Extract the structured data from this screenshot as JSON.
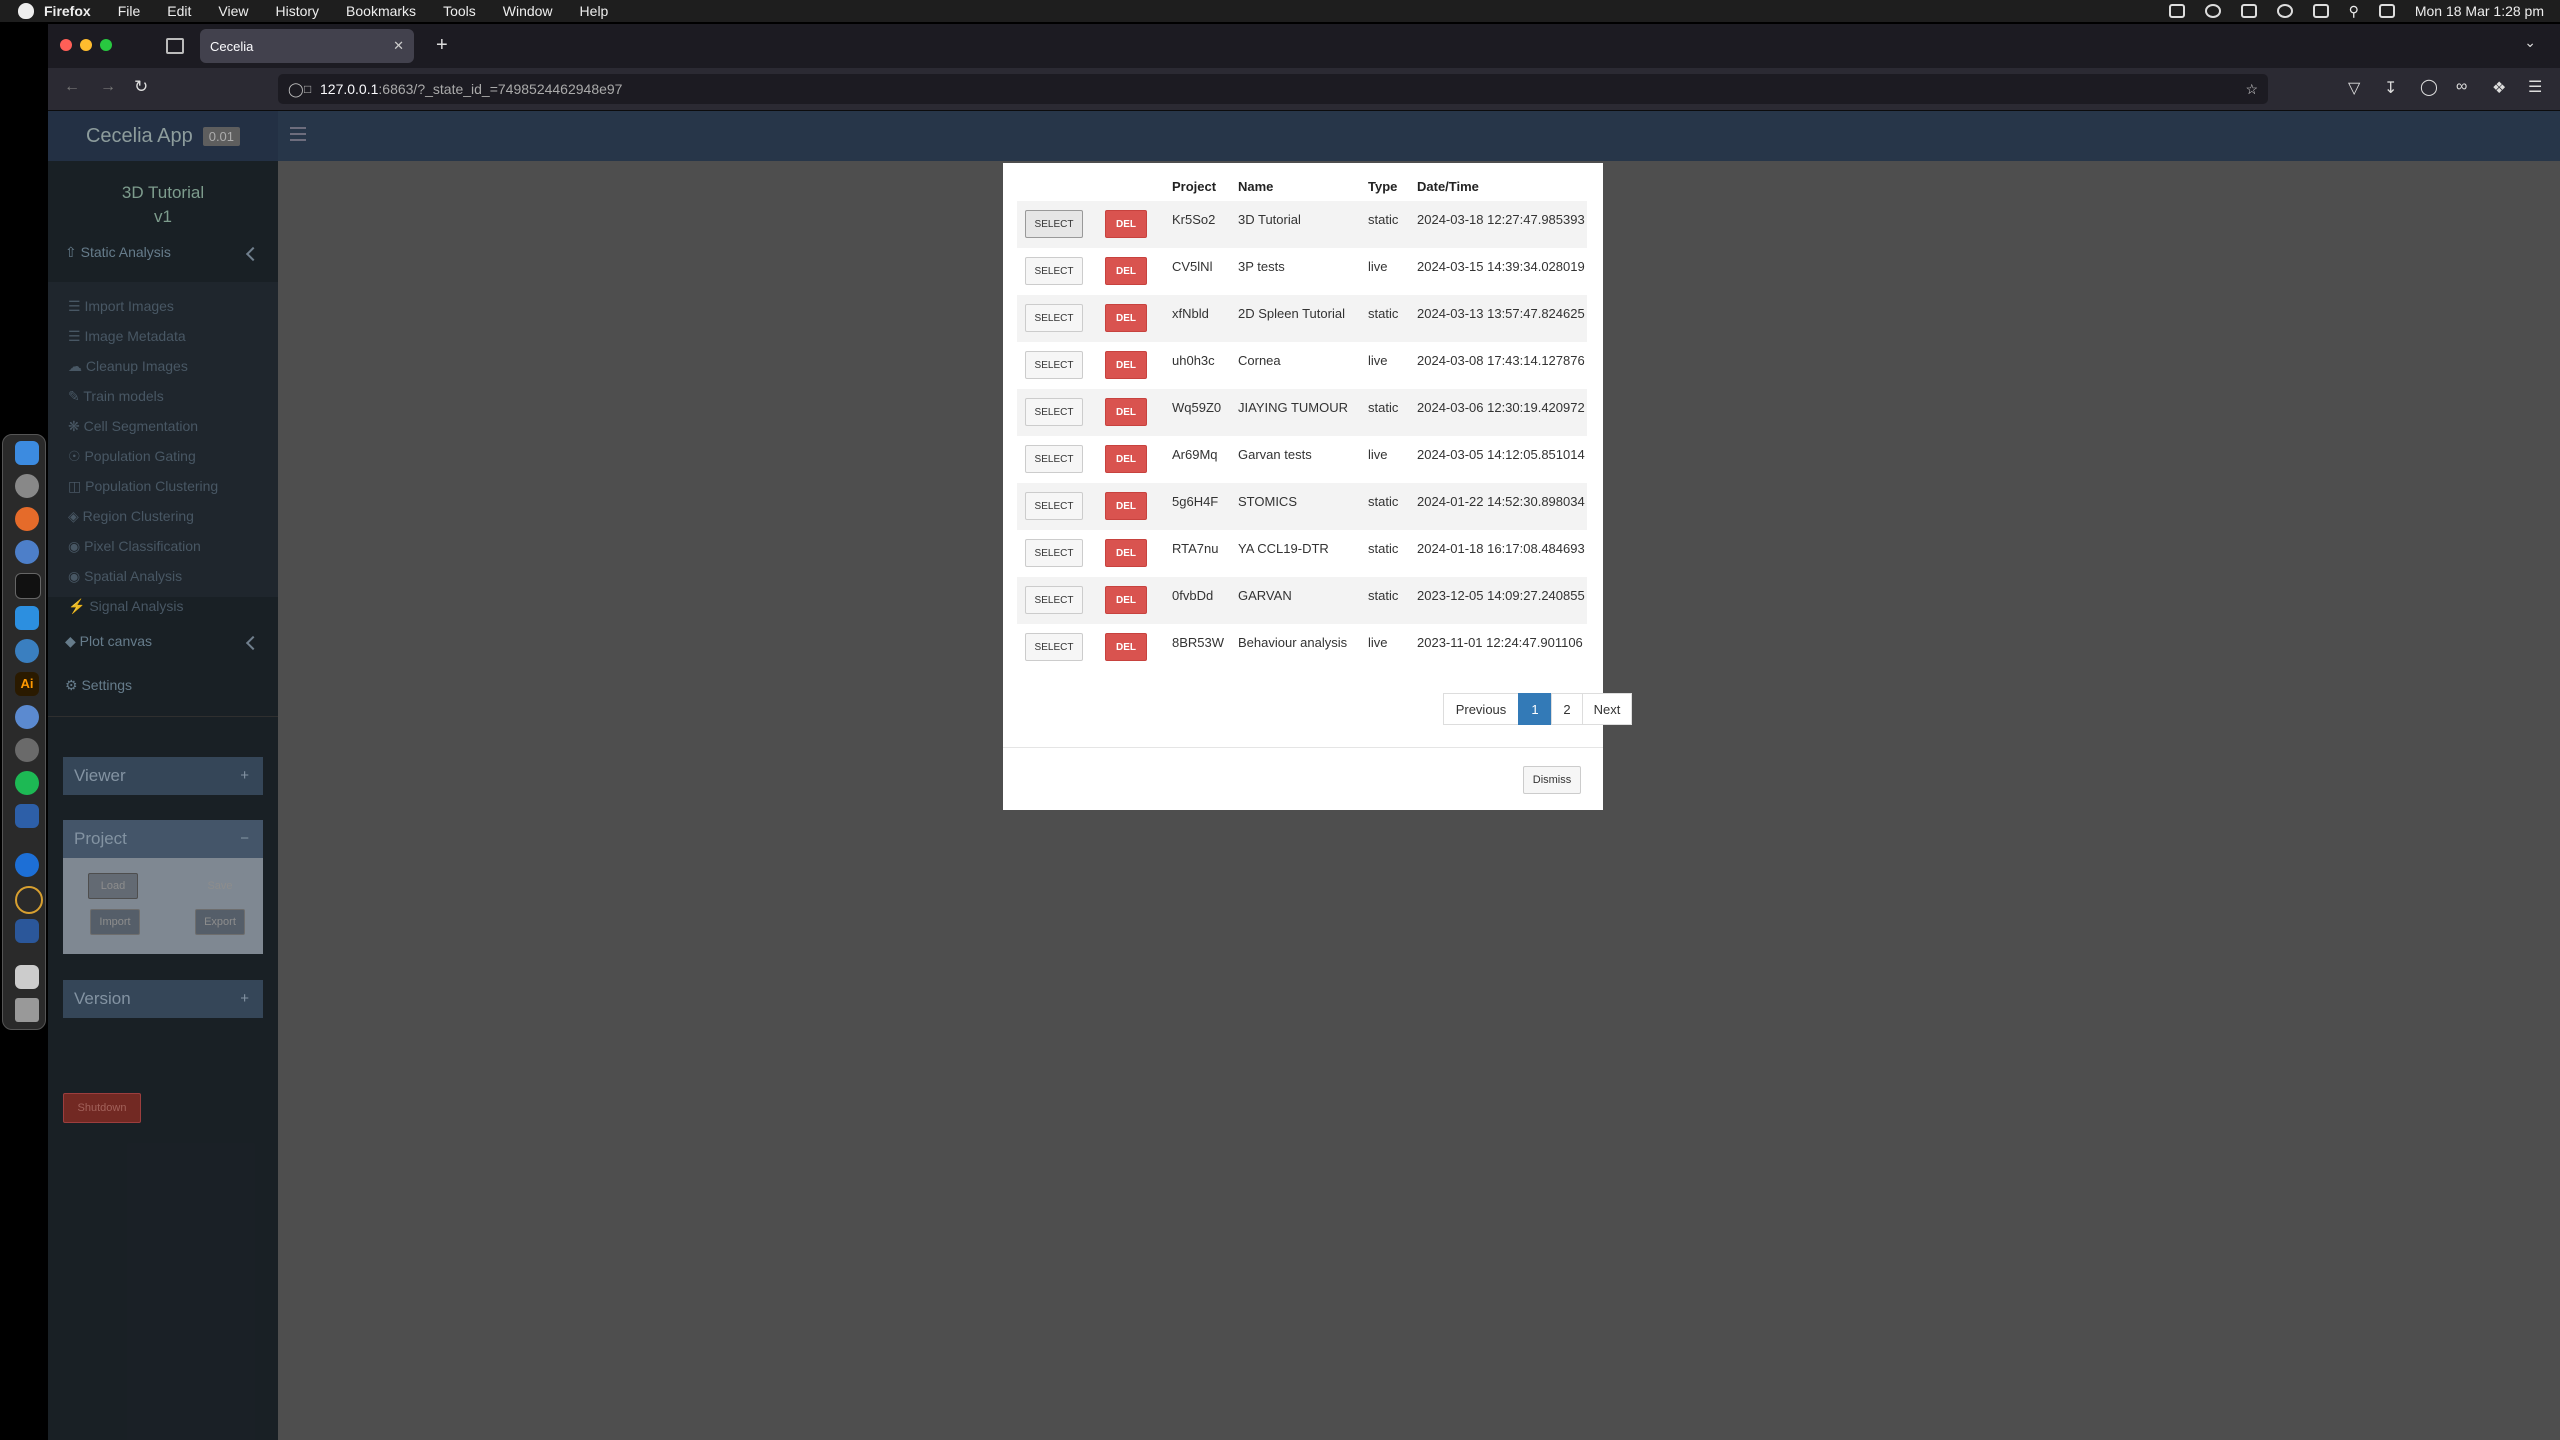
{
  "menubar": {
    "items": [
      "Firefox",
      "File",
      "Edit",
      "View",
      "History",
      "Bookmarks",
      "Tools",
      "Window",
      "Help"
    ],
    "datetime": "Mon 18 Mar  1:28 pm"
  },
  "browser": {
    "tab_title": "Cecelia",
    "url_host": "127.0.0.1",
    "url_rest": ":6863/?_state_id_=7498524462948e97"
  },
  "app": {
    "name": "Cecelia App",
    "version_badge": "0.01",
    "project_title": "3D Tutorial",
    "project_version": "v1",
    "static_analysis": "Static Analysis",
    "static_items": [
      "Import Images",
      "Image Metadata",
      "Cleanup Images",
      "Train models",
      "Cell Segmentation",
      "Population Gating",
      "Population Clustering",
      "Region Clustering",
      "Pixel Classification",
      "Spatial Analysis",
      "Signal Analysis"
    ],
    "plot_canvas": "Plot canvas",
    "settings": "Settings",
    "viewer": "Viewer",
    "project": "Project",
    "project_buttons": {
      "load": "Load",
      "save": "Save",
      "import": "Import",
      "export": "Export"
    },
    "version": "Version",
    "shutdown": "Shutdown"
  },
  "modal": {
    "headers": {
      "project": "Project",
      "name": "Name",
      "type": "Type",
      "datetime": "Date/Time"
    },
    "select_label": "SELECT",
    "del_label": "DEL",
    "rows": [
      {
        "project": "Kr5So2",
        "name": "3D Tutorial",
        "type": "static",
        "datetime": "2024-03-18 12:27:47.985393"
      },
      {
        "project": "CV5lNl",
        "name": "3P tests",
        "type": "live",
        "datetime": "2024-03-15 14:39:34.028019"
      },
      {
        "project": "xfNbld",
        "name": "2D Spleen Tutorial",
        "type": "static",
        "datetime": "2024-03-13 13:57:47.824625"
      },
      {
        "project": "uh0h3c",
        "name": "Cornea",
        "type": "live",
        "datetime": "2024-03-08 17:43:14.127876"
      },
      {
        "project": "Wq59Z0",
        "name": "JIAYING TUMOUR",
        "type": "static",
        "datetime": "2024-03-06 12:30:19.420972"
      },
      {
        "project": "Ar69Mq",
        "name": "Garvan tests",
        "type": "live",
        "datetime": "2024-03-05 14:12:05.851014"
      },
      {
        "project": "5g6H4F",
        "name": "STOMICS",
        "type": "static",
        "datetime": "2024-01-22 14:52:30.898034"
      },
      {
        "project": "RTA7nu",
        "name": "YA CCL19-DTR",
        "type": "static",
        "datetime": "2024-01-18 16:17:08.484693"
      },
      {
        "project": "0fvbDd",
        "name": "GARVAN",
        "type": "static",
        "datetime": "2023-12-05 14:09:27.240855"
      },
      {
        "project": "8BR53W",
        "name": "Behaviour analysis",
        "type": "live",
        "datetime": "2023-11-01 12:24:47.901106"
      }
    ],
    "pagination": {
      "previous": "Previous",
      "page1": "1",
      "page2": "2",
      "next": "Next"
    },
    "dismiss": "Dismiss"
  }
}
